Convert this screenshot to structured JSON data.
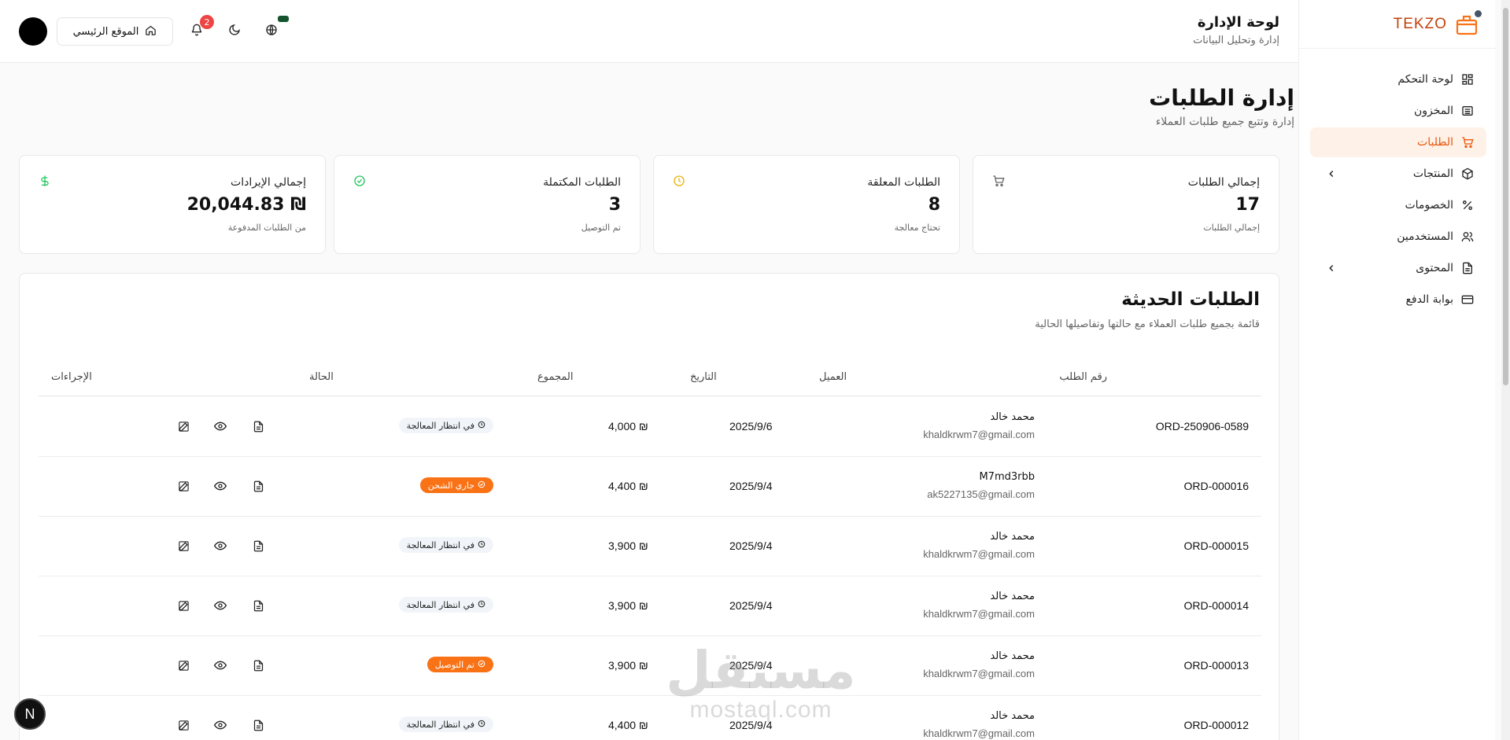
{
  "brand": {
    "name": "TEKZO",
    "accent": "#ea580c"
  },
  "sidebar": {
    "items": [
      {
        "label": "لوحة التحكم",
        "icon": "dashboard-icon",
        "active": false,
        "chevron": false
      },
      {
        "label": "المخزون",
        "icon": "warehouse-icon",
        "active": false,
        "chevron": false
      },
      {
        "label": "الطلبات",
        "icon": "cart-icon",
        "active": true,
        "chevron": false
      },
      {
        "label": "المنتجات",
        "icon": "box-icon",
        "active": false,
        "chevron": true
      },
      {
        "label": "الخصومات",
        "icon": "percent-icon",
        "active": false,
        "chevron": false
      },
      {
        "label": "المستخدمين",
        "icon": "users-icon",
        "active": false,
        "chevron": false
      },
      {
        "label": "المحتوى",
        "icon": "document-icon",
        "active": false,
        "chevron": true
      },
      {
        "label": "بوابة الدفع",
        "icon": "credit-card-icon",
        "active": false,
        "chevron": false
      }
    ]
  },
  "header": {
    "title": "لوحة الإدارة",
    "subtitle": "إدارة وتحليل البيانات",
    "home_label": "الموقع الرئيسي",
    "notifications_count": "2"
  },
  "page": {
    "title": "إدارة الطلبات",
    "subtitle": "إدارة وتتبع جميع طلبات العملاء"
  },
  "stats": [
    {
      "title": "إجمالي الطلبات",
      "value": "17",
      "sub": "إجمالي الطلبات",
      "icon": "cart-icon",
      "color": "#666666"
    },
    {
      "title": "الطلبات المعلقة",
      "value": "8",
      "sub": "تحتاج معالجة",
      "icon": "clock-icon",
      "color": "#eab308"
    },
    {
      "title": "الطلبات المكتملة",
      "value": "3",
      "sub": "تم التوصيل",
      "icon": "check-circle-icon",
      "color": "#22c55e"
    },
    {
      "title": "إجمالي الإيرادات",
      "value": "20,044.83 ₪",
      "sub": "من الطلبات المدفوعة",
      "icon": "dollar-icon",
      "color": "#22c55e"
    }
  ],
  "orders": {
    "title": "الطلبات الحديثة",
    "subtitle": "قائمة بجميع طلبات العملاء مع حالتها وتفاصيلها الحالية",
    "columns": {
      "id": "رقم الطلب",
      "customer": "العميل",
      "date": "التاريخ",
      "total": "المجموع",
      "status": "الحالة",
      "actions": "الإجراءات"
    },
    "rows": [
      {
        "id": "ORD-250906-0589",
        "name": "محمد خالد",
        "email": "khaldkrwm7@gmail.com",
        "date": "2025/9/6",
        "total": "4,000 ₪",
        "status": "في انتظار المعالجة",
        "status_type": "pending"
      },
      {
        "id": "ORD-000016",
        "name": "M7md3rbb",
        "email": "ak5227135@gmail.com",
        "date": "2025/9/4",
        "total": "4,400 ₪",
        "status": "جاري الشحن",
        "status_type": "orange"
      },
      {
        "id": "ORD-000015",
        "name": "محمد خالد",
        "email": "khaldkrwm7@gmail.com",
        "date": "2025/9/4",
        "total": "3,900 ₪",
        "status": "في انتظار المعالجة",
        "status_type": "pending"
      },
      {
        "id": "ORD-000014",
        "name": "محمد خالد",
        "email": "khaldkrwm7@gmail.com",
        "date": "2025/9/4",
        "total": "3,900 ₪",
        "status": "في انتظار المعالجة",
        "status_type": "pending"
      },
      {
        "id": "ORD-000013",
        "name": "محمد خالد",
        "email": "khaldkrwm7@gmail.com",
        "date": "2025/9/4",
        "total": "3,900 ₪",
        "status": "تم التوصيل",
        "status_type": "orange"
      },
      {
        "id": "ORD-000012",
        "name": "محمد خالد",
        "email": "khaldkrwm7@gmail.com",
        "date": "2025/9/4",
        "total": "4,400 ₪",
        "status": "في انتظار المعالجة",
        "status_type": "pending"
      }
    ]
  },
  "fab_label": "N",
  "watermark": {
    "line1": "مستقل",
    "line2": "mostaql.com"
  }
}
